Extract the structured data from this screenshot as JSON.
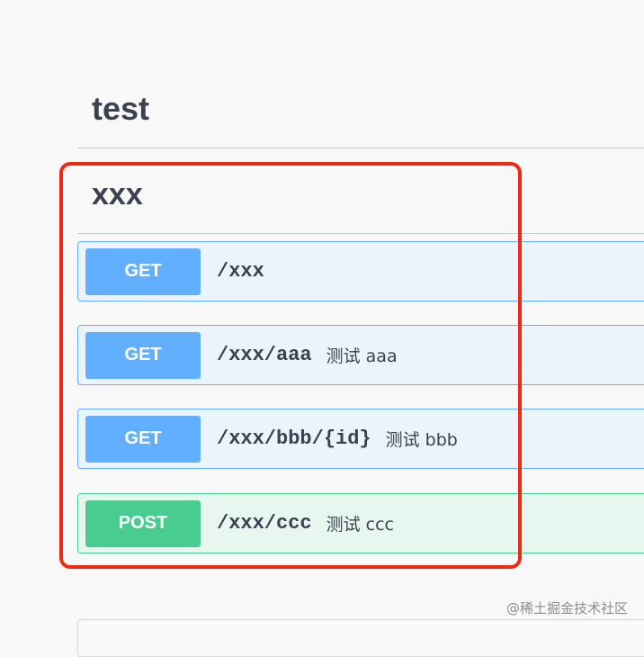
{
  "section": {
    "title": "test"
  },
  "tag": {
    "title": "xxx"
  },
  "operations": [
    {
      "method": "GET",
      "path": "/xxx",
      "summary": ""
    },
    {
      "method": "GET",
      "path": "/xxx/aaa",
      "summary": "测试 aaa"
    },
    {
      "method": "GET",
      "path": "/xxx/bbb/{id}",
      "summary": "测试 bbb"
    },
    {
      "method": "POST",
      "path": "/xxx/ccc",
      "summary": "测试 ccc"
    }
  ],
  "watermark": "@稀土掘金技术社区",
  "colors": {
    "get": "#61affe",
    "post": "#49cc90",
    "highlight": "#f02a12"
  }
}
